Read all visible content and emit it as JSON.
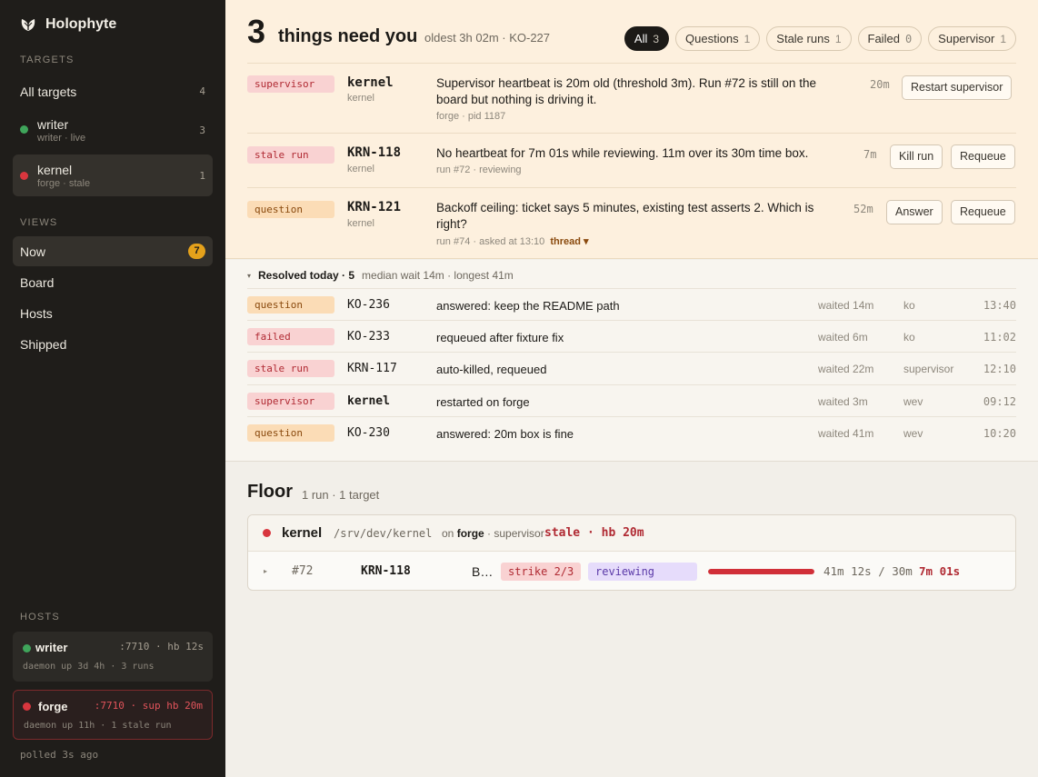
{
  "app": {
    "name": "Holophyte"
  },
  "sidebar": {
    "targets_label": "TARGETS",
    "targets": [
      {
        "label": "All targets",
        "count": "4"
      },
      {
        "label": "writer",
        "sub": "writer · live",
        "count": "3",
        "status": "green"
      },
      {
        "label": "kernel",
        "sub": "forge · stale",
        "count": "1",
        "status": "red"
      }
    ],
    "views_label": "VIEWS",
    "views": [
      {
        "label": "Now",
        "badge": "7"
      },
      {
        "label": "Board"
      },
      {
        "label": "Hosts"
      },
      {
        "label": "Shipped"
      }
    ],
    "hosts_label": "HOSTS",
    "hosts": [
      {
        "name": "writer",
        "meta": ":7710 · hb 12s",
        "sub": "daemon up 3d 4h · 3 runs",
        "status": "green"
      },
      {
        "name": "forge",
        "meta": ":7710 · sup hb 20m",
        "sub": "daemon up 11h · 1 stale run",
        "status": "red"
      }
    ],
    "polled": "polled 3s ago"
  },
  "needs": {
    "count": "3",
    "title": "things need you",
    "subtitle": "oldest 3h 02m · KO-227",
    "filters": [
      {
        "label": "All",
        "count": "3",
        "active": true
      },
      {
        "label": "Questions",
        "count": "1"
      },
      {
        "label": "Stale runs",
        "count": "1"
      },
      {
        "label": "Failed",
        "count": "0"
      },
      {
        "label": "Supervisor",
        "count": "1"
      }
    ],
    "items": [
      {
        "tag": "supervisor",
        "id": "kernel",
        "target": "kernel",
        "message": "Supervisor heartbeat is 20m old (threshold 3m). Run #72 is still on the board but nothing is driving it.",
        "meta": "forge · pid 1187",
        "age": "20m",
        "actions": [
          "Restart supervisor"
        ]
      },
      {
        "tag": "stale run",
        "id": "KRN-118",
        "target": "kernel",
        "message": "No heartbeat for 7m 01s while reviewing. 11m over its 30m time box.",
        "meta": "run #72 · reviewing",
        "age": "7m",
        "actions": [
          "Kill run",
          "Requeue"
        ]
      },
      {
        "tag": "question",
        "id": "KRN-121",
        "target": "kernel",
        "message": "Backoff ceiling: ticket says 5 minutes, existing test asserts 2. Which is right?",
        "meta": "run #74 · asked at 13:10",
        "thread": "thread ▾",
        "age": "52m",
        "actions": [
          "Answer",
          "Requeue"
        ]
      }
    ]
  },
  "resolved": {
    "title": "Resolved today · 5",
    "summary": "median wait 14m · longest 41m",
    "rows": [
      {
        "tag": "question",
        "id": "KO-236",
        "message": "answered: keep the README path",
        "wait": "waited 14m",
        "who": "ko",
        "time": "13:40"
      },
      {
        "tag": "failed",
        "id": "KO-233",
        "message": "requeued after fixture fix",
        "wait": "waited 6m",
        "who": "ko",
        "time": "11:02"
      },
      {
        "tag": "stale run",
        "id": "KRN-117",
        "message": "auto-killed, requeued",
        "wait": "waited 22m",
        "who": "supervisor",
        "time": "12:10"
      },
      {
        "tag": "supervisor",
        "id": "kernel",
        "message": "restarted on forge",
        "wait": "waited 3m",
        "who": "wev",
        "time": "09:12"
      },
      {
        "tag": "question",
        "id": "KO-230",
        "message": "answered: 20m box is fine",
        "wait": "waited 41m",
        "who": "wev",
        "time": "10:20"
      }
    ]
  },
  "floor": {
    "title": "Floor",
    "subtitle": "1 run · 1 target",
    "target": {
      "name": "kernel",
      "path": "/srv/dev/kernel",
      "on_prefix": "on",
      "host": "forge",
      "on_suffix": "· supervisor",
      "status": "stale · hb 20m"
    },
    "run": {
      "num": "#72",
      "ticket": "KRN-118",
      "title": "B…",
      "strike": "strike 2/3",
      "phase": "reviewing",
      "progress": 1.0,
      "elapsed": "41m 12s / 30m",
      "over": "7m 01s"
    }
  },
  "colors": {
    "accent": "#e4a11b",
    "danger": "#d8363e",
    "ok": "#3fa55b"
  }
}
